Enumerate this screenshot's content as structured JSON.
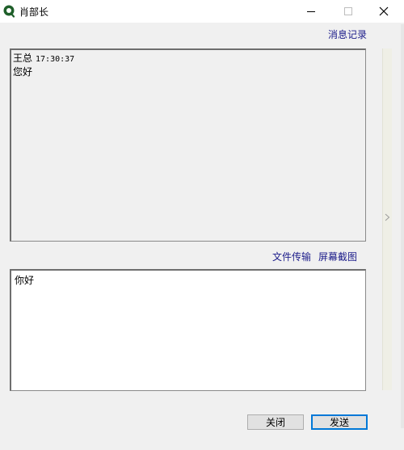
{
  "window": {
    "title": "肖部长"
  },
  "toolbar": {
    "history_link": "消息记录"
  },
  "history": {
    "messages": [
      {
        "sender": "王总",
        "time": "17:30:37",
        "text": "您好"
      }
    ]
  },
  "actions": {
    "file_transfer": "文件传输",
    "screenshot": "屏幕截图"
  },
  "compose": {
    "text": "你好"
  },
  "buttons": {
    "close_label": "关闭",
    "send_label": "发送"
  },
  "colors": {
    "link": "#1c1c8a",
    "app_icon": "#1f5f2a",
    "send_border": "#0078d7"
  }
}
